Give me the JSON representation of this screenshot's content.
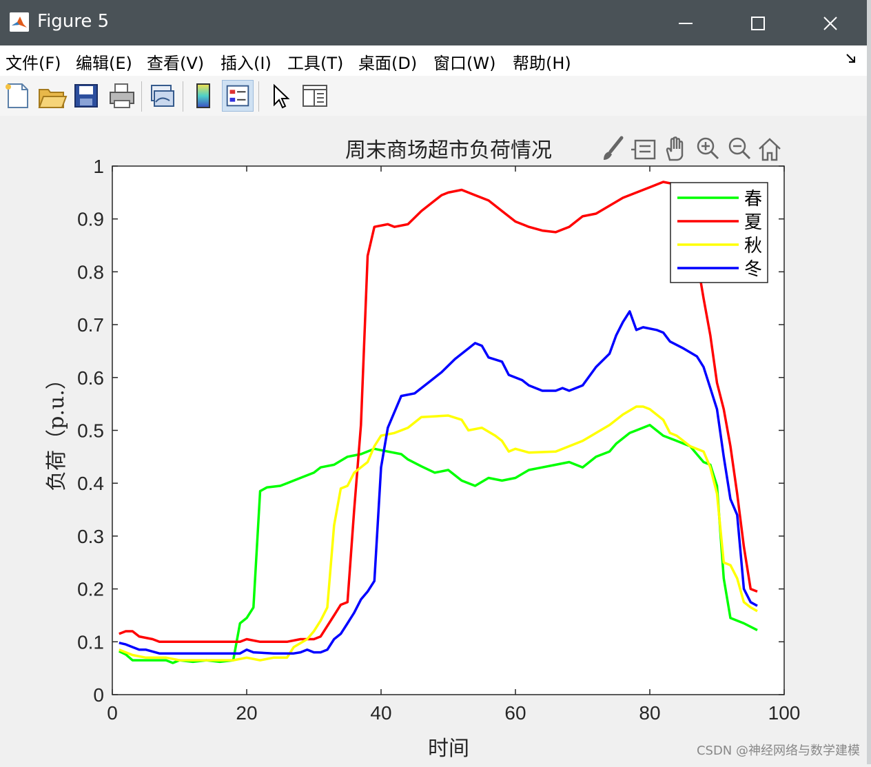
{
  "window": {
    "title": "Figure 5",
    "minimize_icon": "minimize-icon",
    "maximize_icon": "maximize-icon",
    "close_icon": "close-icon"
  },
  "menu": [
    "文件(F)",
    "编辑(E)",
    "查看(V)",
    "插入(I)",
    "工具(T)",
    "桌面(D)",
    "窗口(W)",
    "帮助(H)"
  ],
  "toolbar": [
    "new-figure-icon",
    "open-file-icon",
    "save-icon",
    "print-icon",
    "link-plot-icon",
    "colorbar-icon",
    "legend-icon",
    "pointer-icon",
    "property-inspector-icon"
  ],
  "axes_toolbar": [
    "brush-icon",
    "data-tips-icon",
    "pan-icon",
    "zoom-in-icon",
    "zoom-out-icon",
    "home-icon"
  ],
  "watermark": "CSDN @神经网络与数学建模",
  "chart_data": {
    "type": "line",
    "title": "周末商场超市负荷情况",
    "xlabel": "时间",
    "ylabel": "负荷（p.u.）",
    "xlim": [
      0,
      100
    ],
    "ylim": [
      0,
      1
    ],
    "xticks": [
      "0",
      "20",
      "40",
      "60",
      "80",
      "100"
    ],
    "yticks": [
      "0",
      "0.1",
      "0.2",
      "0.3",
      "0.4",
      "0.5",
      "0.6",
      "0.7",
      "0.8",
      "0.9",
      "1"
    ],
    "grid": false,
    "legend_position": "top-right",
    "series": [
      {
        "name": "春",
        "color": "#00ff00",
        "points": [
          [
            1,
            0.082
          ],
          [
            2,
            0.076
          ],
          [
            3,
            0.065
          ],
          [
            5,
            0.065
          ],
          [
            8,
            0.065
          ],
          [
            9,
            0.06
          ],
          [
            10,
            0.065
          ],
          [
            12,
            0.062
          ],
          [
            14,
            0.065
          ],
          [
            16,
            0.062
          ],
          [
            18,
            0.065
          ],
          [
            19,
            0.135
          ],
          [
            20,
            0.145
          ],
          [
            21,
            0.165
          ],
          [
            22,
            0.385
          ],
          [
            23,
            0.392
          ],
          [
            25,
            0.395
          ],
          [
            26,
            0.4
          ],
          [
            28,
            0.41
          ],
          [
            30,
            0.42
          ],
          [
            31,
            0.43
          ],
          [
            33,
            0.435
          ],
          [
            35,
            0.45
          ],
          [
            37,
            0.455
          ],
          [
            39,
            0.465
          ],
          [
            41,
            0.46
          ],
          [
            43,
            0.455
          ],
          [
            44,
            0.445
          ],
          [
            46,
            0.432
          ],
          [
            48,
            0.42
          ],
          [
            50,
            0.425
          ],
          [
            52,
            0.405
          ],
          [
            54,
            0.395
          ],
          [
            56,
            0.41
          ],
          [
            58,
            0.405
          ],
          [
            60,
            0.41
          ],
          [
            62,
            0.425
          ],
          [
            64,
            0.43
          ],
          [
            66,
            0.435
          ],
          [
            68,
            0.44
          ],
          [
            70,
            0.43
          ],
          [
            72,
            0.45
          ],
          [
            74,
            0.46
          ],
          [
            75,
            0.475
          ],
          [
            77,
            0.495
          ],
          [
            78,
            0.5
          ],
          [
            80,
            0.51
          ],
          [
            82,
            0.49
          ],
          [
            84,
            0.48
          ],
          [
            86,
            0.47
          ],
          [
            88,
            0.44
          ],
          [
            89,
            0.435
          ],
          [
            90,
            0.395
          ],
          [
            91,
            0.22
          ],
          [
            92,
            0.145
          ],
          [
            94,
            0.135
          ],
          [
            96,
            0.122
          ]
        ]
      },
      {
        "name": "夏",
        "color": "#ff0000",
        "points": [
          [
            1,
            0.115
          ],
          [
            2,
            0.12
          ],
          [
            3,
            0.12
          ],
          [
            4,
            0.11
          ],
          [
            6,
            0.105
          ],
          [
            7,
            0.1
          ],
          [
            10,
            0.1
          ],
          [
            15,
            0.1
          ],
          [
            19,
            0.1
          ],
          [
            20,
            0.105
          ],
          [
            22,
            0.1
          ],
          [
            26,
            0.1
          ],
          [
            28,
            0.105
          ],
          [
            30,
            0.105
          ],
          [
            31,
            0.11
          ],
          [
            33,
            0.15
          ],
          [
            34,
            0.17
          ],
          [
            35,
            0.175
          ],
          [
            36,
            0.35
          ],
          [
            37,
            0.51
          ],
          [
            38,
            0.83
          ],
          [
            39,
            0.885
          ],
          [
            41,
            0.89
          ],
          [
            42,
            0.885
          ],
          [
            44,
            0.89
          ],
          [
            46,
            0.915
          ],
          [
            48,
            0.935
          ],
          [
            49,
            0.945
          ],
          [
            50,
            0.95
          ],
          [
            52,
            0.955
          ],
          [
            54,
            0.945
          ],
          [
            56,
            0.935
          ],
          [
            58,
            0.915
          ],
          [
            60,
            0.895
          ],
          [
            62,
            0.885
          ],
          [
            64,
            0.878
          ],
          [
            66,
            0.875
          ],
          [
            67,
            0.88
          ],
          [
            68,
            0.885
          ],
          [
            70,
            0.905
          ],
          [
            72,
            0.91
          ],
          [
            74,
            0.925
          ],
          [
            76,
            0.94
          ],
          [
            78,
            0.95
          ],
          [
            80,
            0.96
          ],
          [
            82,
            0.97
          ],
          [
            84,
            0.965
          ],
          [
            85,
            0.95
          ],
          [
            86,
            0.9
          ],
          [
            88,
            0.75
          ],
          [
            89,
            0.68
          ],
          [
            90,
            0.59
          ],
          [
            91,
            0.54
          ],
          [
            92,
            0.47
          ],
          [
            93,
            0.38
          ],
          [
            94,
            0.28
          ],
          [
            95,
            0.2
          ],
          [
            96,
            0.195
          ]
        ]
      },
      {
        "name": "秋",
        "color": "#ffff00",
        "points": [
          [
            1,
            0.085
          ],
          [
            2,
            0.08
          ],
          [
            3,
            0.075
          ],
          [
            5,
            0.07
          ],
          [
            8,
            0.07
          ],
          [
            10,
            0.065
          ],
          [
            14,
            0.065
          ],
          [
            18,
            0.065
          ],
          [
            20,
            0.07
          ],
          [
            22,
            0.065
          ],
          [
            24,
            0.07
          ],
          [
            26,
            0.07
          ],
          [
            27,
            0.09
          ],
          [
            29,
            0.105
          ],
          [
            30,
            0.12
          ],
          [
            31,
            0.14
          ],
          [
            32,
            0.165
          ],
          [
            33,
            0.32
          ],
          [
            34,
            0.39
          ],
          [
            35,
            0.395
          ],
          [
            36,
            0.42
          ],
          [
            38,
            0.44
          ],
          [
            39,
            0.47
          ],
          [
            40,
            0.49
          ],
          [
            42,
            0.495
          ],
          [
            44,
            0.505
          ],
          [
            46,
            0.525
          ],
          [
            50,
            0.528
          ],
          [
            52,
            0.52
          ],
          [
            53,
            0.5
          ],
          [
            55,
            0.505
          ],
          [
            57,
            0.49
          ],
          [
            58,
            0.48
          ],
          [
            59,
            0.46
          ],
          [
            60,
            0.465
          ],
          [
            62,
            0.458
          ],
          [
            66,
            0.46
          ],
          [
            68,
            0.47
          ],
          [
            70,
            0.48
          ],
          [
            72,
            0.495
          ],
          [
            74,
            0.51
          ],
          [
            76,
            0.53
          ],
          [
            78,
            0.545
          ],
          [
            79,
            0.545
          ],
          [
            80,
            0.54
          ],
          [
            82,
            0.52
          ],
          [
            83,
            0.495
          ],
          [
            84,
            0.49
          ],
          [
            86,
            0.47
          ],
          [
            88,
            0.46
          ],
          [
            89,
            0.43
          ],
          [
            90,
            0.38
          ],
          [
            91,
            0.25
          ],
          [
            92,
            0.245
          ],
          [
            93,
            0.22
          ],
          [
            94,
            0.175
          ],
          [
            95,
            0.165
          ],
          [
            96,
            0.158
          ]
        ]
      },
      {
        "name": "冬",
        "color": "#0000ff",
        "points": [
          [
            1,
            0.098
          ],
          [
            2,
            0.095
          ],
          [
            3,
            0.09
          ],
          [
            4,
            0.085
          ],
          [
            5,
            0.085
          ],
          [
            7,
            0.078
          ],
          [
            10,
            0.078
          ],
          [
            18,
            0.078
          ],
          [
            19,
            0.078
          ],
          [
            20,
            0.085
          ],
          [
            21,
            0.08
          ],
          [
            24,
            0.078
          ],
          [
            27,
            0.078
          ],
          [
            28,
            0.08
          ],
          [
            29,
            0.085
          ],
          [
            30,
            0.08
          ],
          [
            31,
            0.08
          ],
          [
            32,
            0.085
          ],
          [
            33,
            0.105
          ],
          [
            34,
            0.115
          ],
          [
            35,
            0.135
          ],
          [
            36,
            0.155
          ],
          [
            37,
            0.18
          ],
          [
            38,
            0.195
          ],
          [
            39,
            0.215
          ],
          [
            40,
            0.43
          ],
          [
            41,
            0.505
          ],
          [
            43,
            0.565
          ],
          [
            45,
            0.57
          ],
          [
            47,
            0.59
          ],
          [
            49,
            0.61
          ],
          [
            51,
            0.635
          ],
          [
            53,
            0.655
          ],
          [
            54,
            0.665
          ],
          [
            55,
            0.66
          ],
          [
            56,
            0.638
          ],
          [
            58,
            0.63
          ],
          [
            59,
            0.605
          ],
          [
            61,
            0.595
          ],
          [
            62,
            0.585
          ],
          [
            64,
            0.575
          ],
          [
            66,
            0.575
          ],
          [
            67,
            0.58
          ],
          [
            68,
            0.575
          ],
          [
            70,
            0.585
          ],
          [
            72,
            0.62
          ],
          [
            74,
            0.645
          ],
          [
            75,
            0.68
          ],
          [
            76,
            0.705
          ],
          [
            77,
            0.725
          ],
          [
            78,
            0.69
          ],
          [
            79,
            0.695
          ],
          [
            81,
            0.69
          ],
          [
            82,
            0.685
          ],
          [
            83,
            0.668
          ],
          [
            85,
            0.655
          ],
          [
            87,
            0.64
          ],
          [
            88,
            0.62
          ],
          [
            89,
            0.58
          ],
          [
            90,
            0.54
          ],
          [
            91,
            0.45
          ],
          [
            92,
            0.37
          ],
          [
            93,
            0.34
          ],
          [
            94,
            0.2
          ],
          [
            95,
            0.175
          ],
          [
            96,
            0.168
          ]
        ]
      }
    ]
  }
}
